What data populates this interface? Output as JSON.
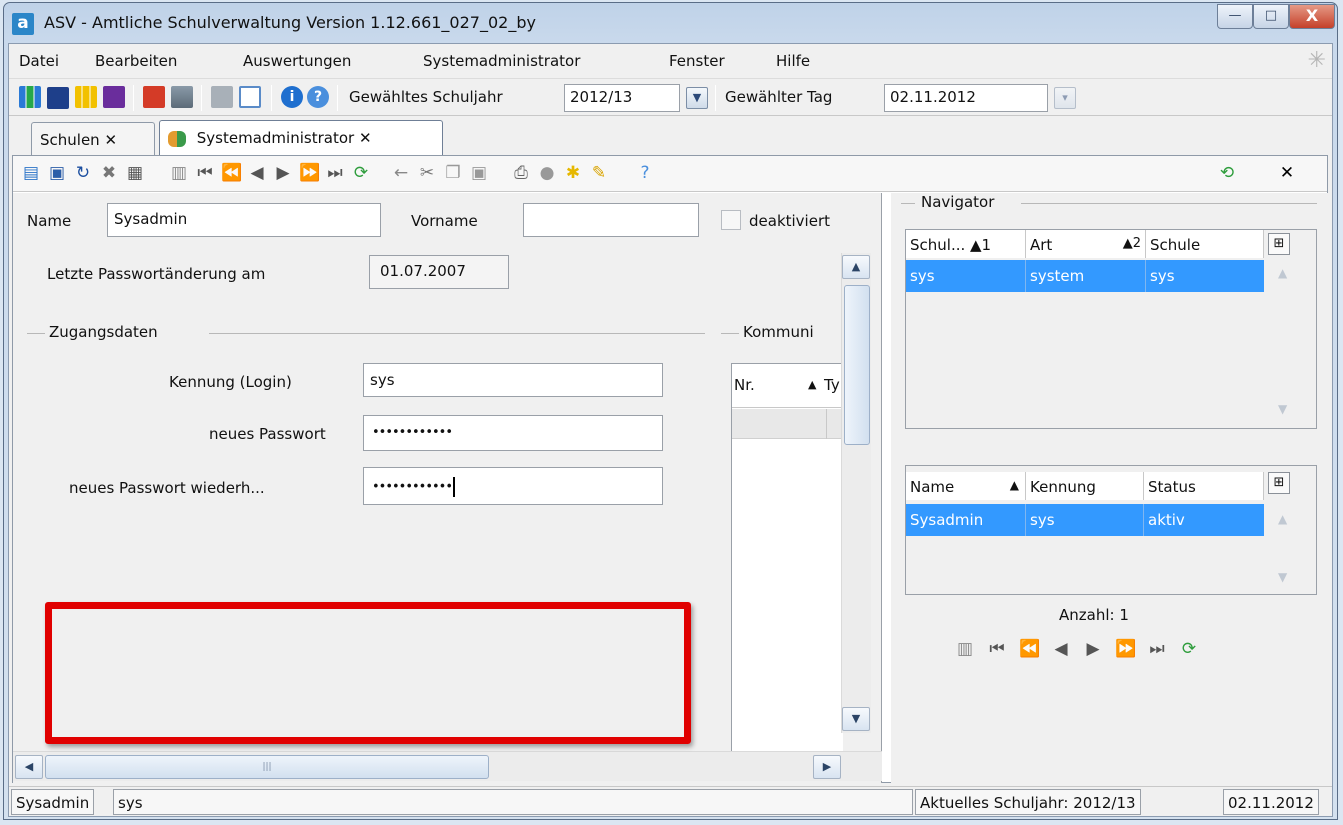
{
  "window": {
    "title": "ASV - Amtliche Schulverwaltung Version 1.12.661_027_02_by",
    "app_icon_letter": "a",
    "minimize": "—",
    "maximize": "□",
    "close": "X"
  },
  "menu": [
    "Datei",
    "Bearbeiten",
    "Auswertungen",
    "Systemadministrator",
    "Fenster",
    "Hilfe"
  ],
  "toolbar": {
    "schuljahr_label": "Gewähltes Schuljahr",
    "schuljahr_value": "2012/13",
    "tag_label": "Gewählter Tag",
    "tag_value": "02.11.2012"
  },
  "tabs": [
    {
      "label": "Schulen",
      "close": "✕"
    },
    {
      "label": "Systemadministrator",
      "close": "✕"
    }
  ],
  "form": {
    "name_label": "Name",
    "name_value": "Sysadmin",
    "vorname_label": "Vorname",
    "vorname_value": "",
    "deaktiviert_label": "deaktiviert",
    "letzte_label": "Letzte Passwortänderung am",
    "letzte_value": "01.07.2007",
    "zugang_group": "Zugangsdaten",
    "kommunikation_group": "Kommuni",
    "kennung_label": "Kennung (Login)",
    "kennung_value": "sys",
    "neues_pw_label": "neues Passwort",
    "neues_pw_value": "••••••••••••",
    "neues_pw_wdh_label": "neues Passwort wiederh...",
    "neues_pw_wdh_value": "••••••••••••",
    "komm_col_nr": "Nr.",
    "komm_col_typ": "Ty"
  },
  "navigator": {
    "title": "Navigator",
    "grid1": {
      "headers": [
        "Schul... ▲1",
        "Art",
        "▲2",
        "Schule"
      ],
      "row": [
        "sys",
        "system",
        "sys"
      ]
    },
    "grid2": {
      "headers": [
        "Name",
        "▲",
        "Kennung",
        "Status"
      ],
      "row": [
        "Sysadmin",
        "sys",
        "aktiv"
      ]
    },
    "count_label": "Anzahl: 1"
  },
  "status": {
    "user": "Sysadmin",
    "login": "sys",
    "schuljahr": "Aktuelles Schuljahr: 2012/13",
    "datum": "02.11.2012"
  },
  "colors": {
    "selection": "#3399ff",
    "highlight_box": "#e00000"
  }
}
